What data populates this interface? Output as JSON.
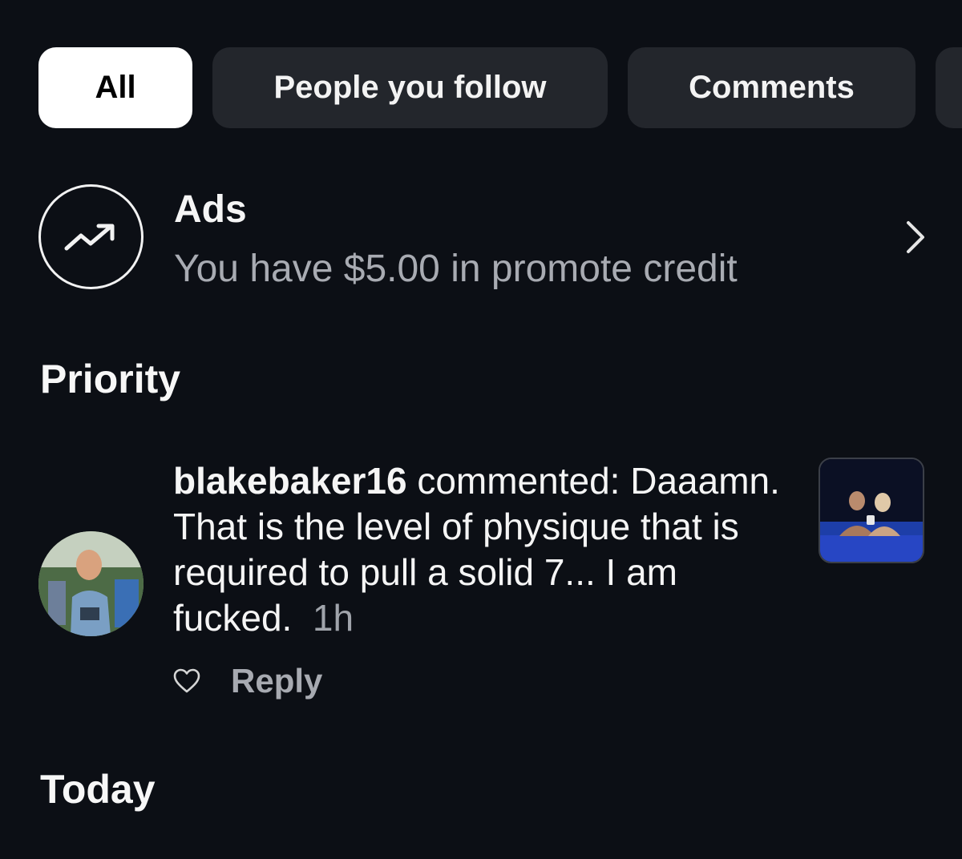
{
  "filters": {
    "tabs": [
      {
        "label": "All",
        "active": true
      },
      {
        "label": "People you follow",
        "active": false
      },
      {
        "label": "Comments",
        "active": false
      },
      {
        "label": "",
        "active": false
      }
    ]
  },
  "ads": {
    "icon": "trending-up-icon",
    "title": "Ads",
    "subtitle": "You have $5.00 in promote credit",
    "chevron_icon": "chevron-right-icon"
  },
  "sections": {
    "priority": "Priority",
    "today": "Today"
  },
  "notification": {
    "username": "blakebaker16",
    "action": " commented:",
    "comment": "Daaamn. That is the level of physique that is required to pull a solid 7... I am fucked.",
    "time": "1h",
    "like_icon": "heart-outline-icon",
    "reply_label": "Reply"
  },
  "colors": {
    "background": "#0c0f15",
    "chip": "#23262c",
    "chip_active": "#ffffff",
    "muted_text": "#a8abb2"
  }
}
